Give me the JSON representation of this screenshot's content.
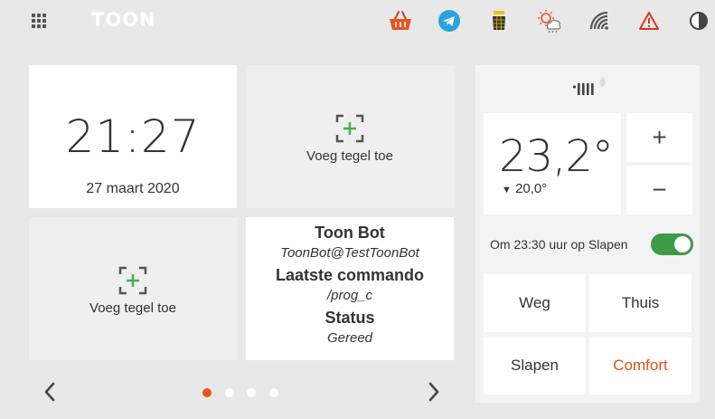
{
  "topbar": {
    "logo": "TOON",
    "icons": [
      "apps-grid-icon",
      "shopping-basket-icon",
      "telegram-icon",
      "solar-panel-icon",
      "weather-icon",
      "wifi-icon",
      "warning-icon",
      "contrast-icon"
    ]
  },
  "clock": {
    "time": "21:27",
    "date": "27 maart 2020"
  },
  "add_tile": {
    "label": "Voeg tegel toe"
  },
  "bot": {
    "title": "Toon Bot",
    "account": "ToonBot@TestToonBot",
    "last_command_label": "Laatste commando",
    "last_command": "/prog_c",
    "status_label": "Status",
    "status": "Gereed"
  },
  "pager": {
    "pages": 4,
    "active": 0
  },
  "thermostat": {
    "current_temp": "23,2°",
    "setpoint": "20,0°",
    "plus": "+",
    "minus": "−",
    "schedule": "Om 23:30 uur op Slapen",
    "program_on": true
  },
  "modes": [
    {
      "label": "Weg",
      "active": false
    },
    {
      "label": "Thuis",
      "active": false
    },
    {
      "label": "Slapen",
      "active": false
    },
    {
      "label": "Comfort",
      "active": true
    }
  ],
  "colors": {
    "accent": "#e8531f",
    "toggle_on": "#3d9a45",
    "add_icon_green": "#4caf50"
  }
}
